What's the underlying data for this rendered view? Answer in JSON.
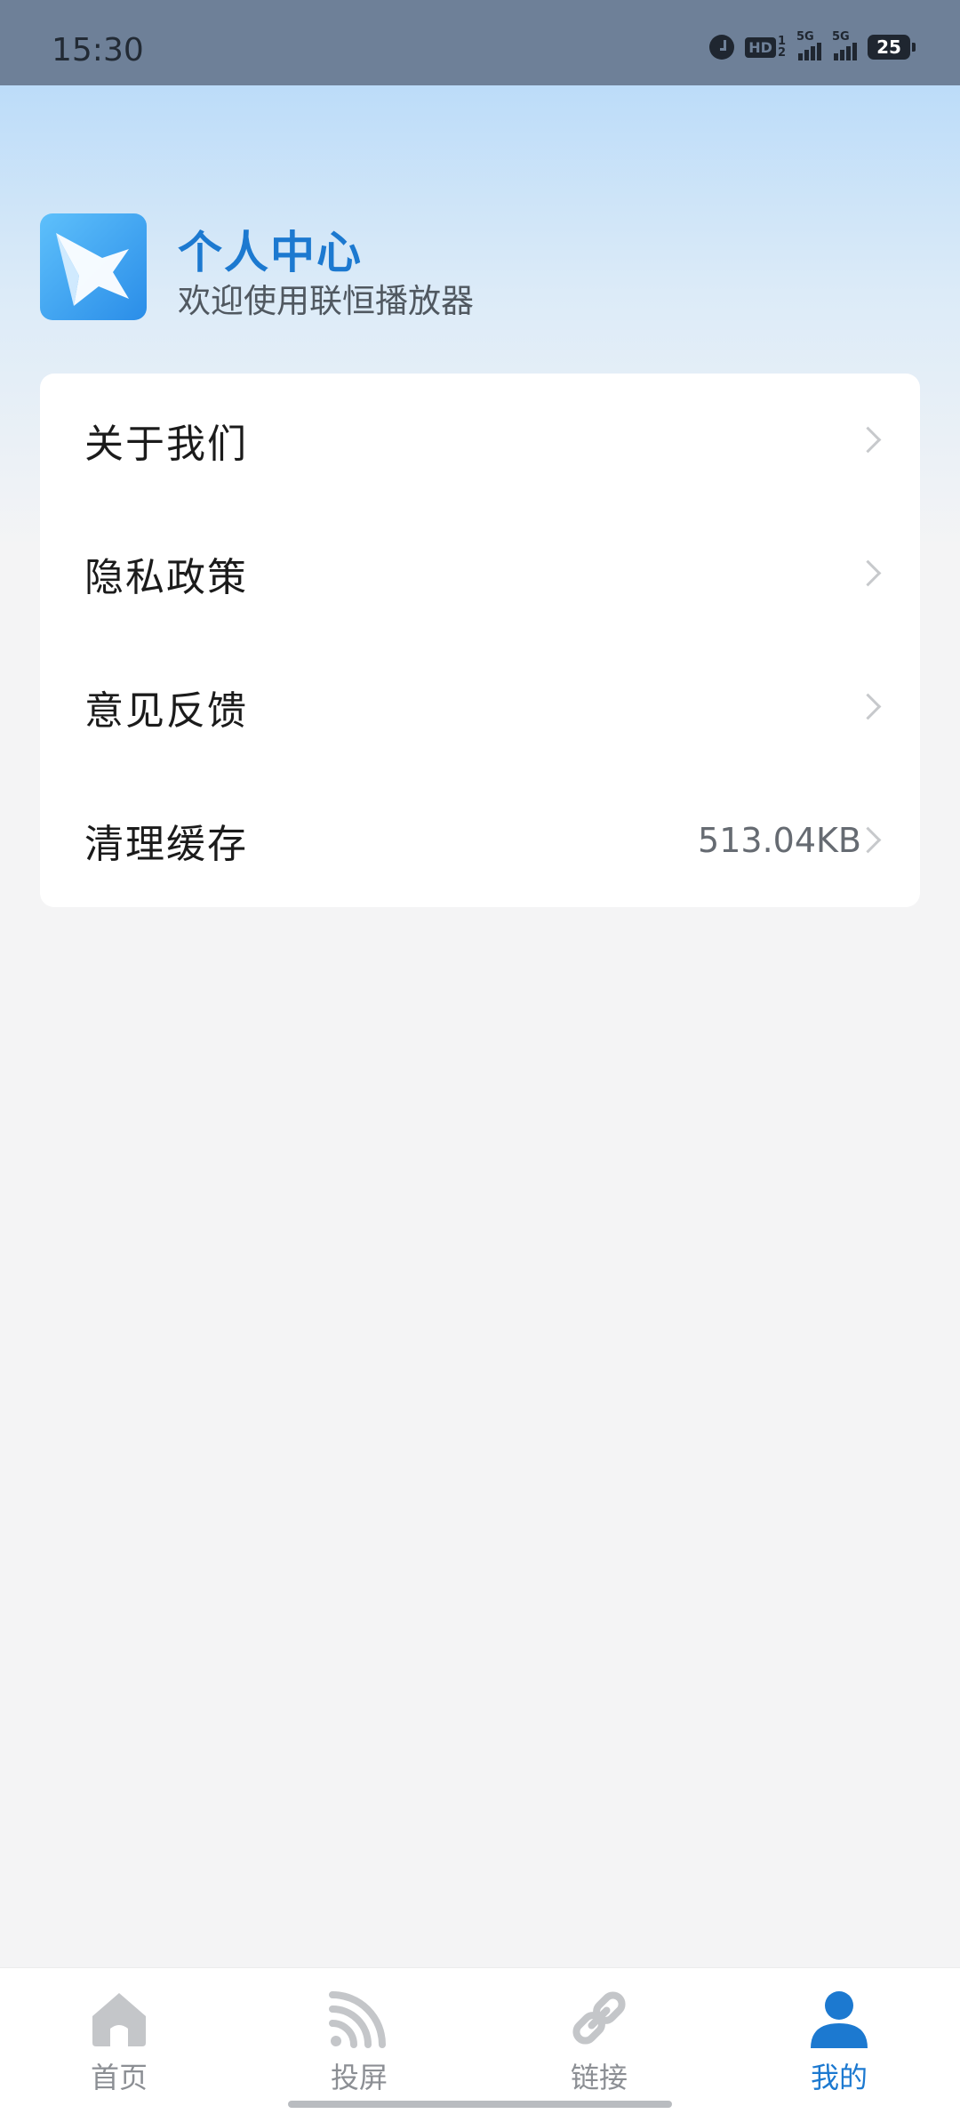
{
  "status_bar": {
    "time": "15:30",
    "hd_label": "HD",
    "hd_sub_top": "1",
    "hd_sub_bottom": "2",
    "sim1_label": "5G",
    "sim2_label": "5G",
    "battery_level": "25",
    "icons": [
      "alarm-icon",
      "hd-voice-icon",
      "signal-icon",
      "signal-icon",
      "battery-icon"
    ]
  },
  "header": {
    "title": "个人中心",
    "subtitle": "欢迎使用联恒播放器",
    "logo_icon": "app-logo-star-icon"
  },
  "menu": {
    "items": [
      {
        "label": "关于我们",
        "value": ""
      },
      {
        "label": "隐私政策",
        "value": ""
      },
      {
        "label": "意见反馈",
        "value": ""
      },
      {
        "label": "清理缓存",
        "value": "513.04KB"
      }
    ]
  },
  "bottom_nav": {
    "items": [
      {
        "label": "首页",
        "icon": "home-icon"
      },
      {
        "label": "投屏",
        "icon": "cast-icon"
      },
      {
        "label": "链接",
        "icon": "link-icon"
      },
      {
        "label": "我的",
        "icon": "profile-icon"
      }
    ],
    "active_index": 3
  },
  "colors": {
    "accent": "#1c79d0",
    "inactive": "#8c8f94",
    "status_bar_bg": "#6e8098",
    "background": "#f4f4f5"
  }
}
